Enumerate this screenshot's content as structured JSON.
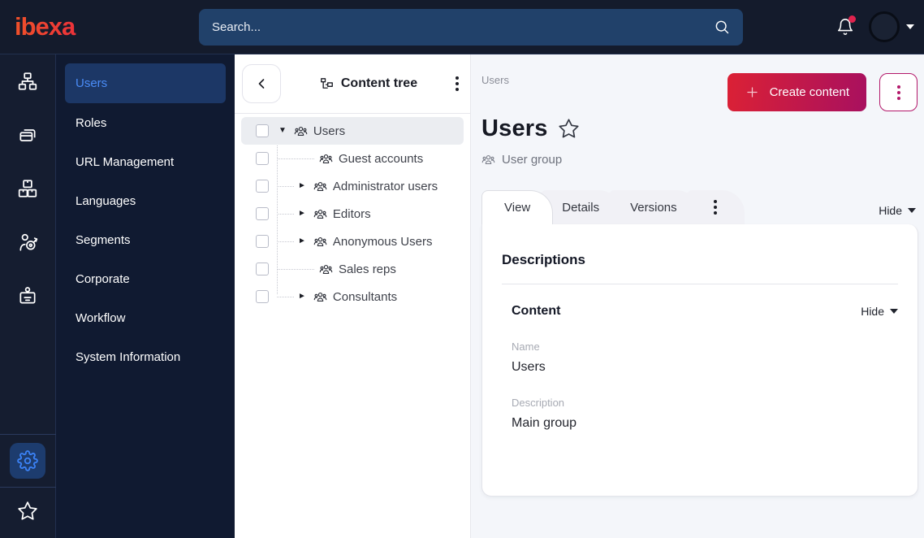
{
  "topbar": {
    "logo": "ibexa",
    "search_placeholder": "Search...",
    "icons": [
      "bell-icon",
      "avatar",
      "chevron-down-icon"
    ]
  },
  "rail": {
    "icons": [
      "sitemap-icon",
      "pages-icon",
      "products-icon",
      "personalization-icon",
      "id-badge-icon",
      "settings-gear-icon",
      "star-icon"
    ],
    "active_icon": "settings-gear-icon"
  },
  "sidebar": {
    "items": [
      {
        "label": "Users",
        "active": true
      },
      {
        "label": "Roles",
        "active": false
      },
      {
        "label": "URL Management",
        "active": false
      },
      {
        "label": "Languages",
        "active": false
      },
      {
        "label": "Segments",
        "active": false
      },
      {
        "label": "Corporate",
        "active": false
      },
      {
        "label": "Workflow",
        "active": false
      },
      {
        "label": "System Information",
        "active": false
      }
    ]
  },
  "content_tree": {
    "title": "Content tree",
    "items": [
      {
        "label": "Users",
        "level": 0,
        "expanded": true,
        "selected": true,
        "has_children": true
      },
      {
        "label": "Guest accounts",
        "level": 1,
        "has_children": false
      },
      {
        "label": "Administrator users",
        "level": 1,
        "has_children": true
      },
      {
        "label": "Editors",
        "level": 1,
        "has_children": true
      },
      {
        "label": "Anonymous Users",
        "level": 1,
        "has_children": true
      },
      {
        "label": "Sales reps",
        "level": 1,
        "has_children": false
      },
      {
        "label": "Consultants",
        "level": 1,
        "has_children": true
      }
    ]
  },
  "main": {
    "breadcrumb": "Users",
    "create_button_label": "Create content",
    "title": "Users",
    "content_type": "User group",
    "tabs": [
      {
        "label": "View",
        "active": true
      },
      {
        "label": "Details",
        "active": false
      },
      {
        "label": "Versions",
        "active": false
      }
    ],
    "hide_label": "Hide",
    "card": {
      "section_title": "Descriptions",
      "subsection_title": "Content",
      "hide_label": "Hide",
      "fields": [
        {
          "label": "Name",
          "value": "Users"
        },
        {
          "label": "Description",
          "value": "Main group"
        }
      ]
    }
  },
  "colors": {
    "topbar_bg": "#141b2c",
    "sidebar_bg": "#101a31",
    "selected_item_bg": "#1c3766",
    "accent_blue": "#4a8cf7",
    "brand_gradient_start": "#db2135",
    "brand_gradient_end": "#a8105f",
    "notification_red": "#e0234e",
    "main_bg": "#f4f6fa"
  }
}
